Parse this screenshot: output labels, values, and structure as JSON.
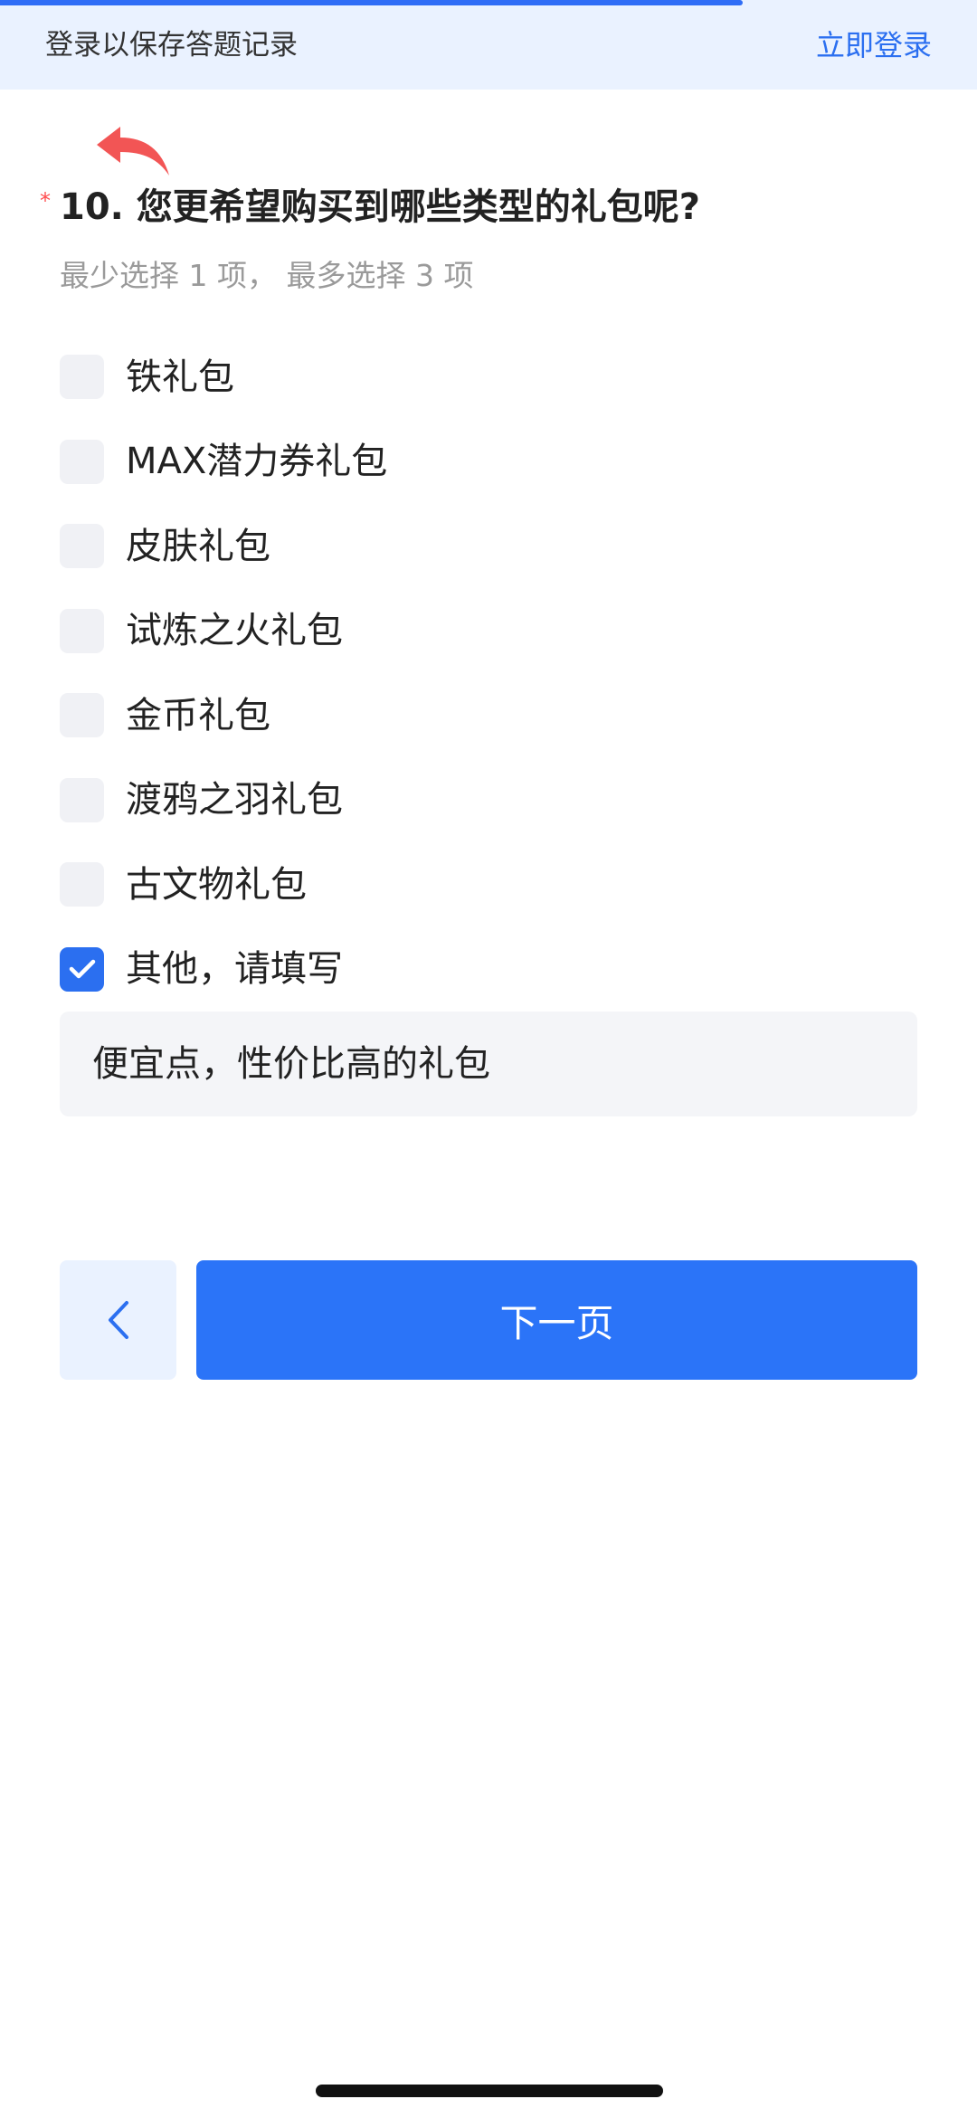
{
  "login_bar": {
    "message": "登录以保存答题记录",
    "login_link": "立即登录",
    "progress_fraction": 0.76
  },
  "question": {
    "required_mark": "*",
    "title": "10. 您更希望购买到哪些类型的礼包呢?",
    "hint": "最少选择 1 项， 最多选择 3 项"
  },
  "options": [
    {
      "label": "铁礼包",
      "checked": false
    },
    {
      "label": "MAX潜力券礼包",
      "checked": false
    },
    {
      "label": "皮肤礼包",
      "checked": false
    },
    {
      "label": "试炼之火礼包",
      "checked": false
    },
    {
      "label": "金币礼包",
      "checked": false
    },
    {
      "label": "渡鸦之羽礼包",
      "checked": false
    },
    {
      "label": "古文物礼包",
      "checked": false
    },
    {
      "label": "其他，请填写",
      "checked": true
    }
  ],
  "other_input": {
    "value": "便宜点，性价比高的礼包"
  },
  "nav": {
    "next_label": "下一页"
  },
  "colors": {
    "accent": "#2b6ff0",
    "bar_bg": "#eaf2ff",
    "checkbox_bg": "#f0f1f5",
    "required": "#ff4d4f",
    "back_arrow": "#f25555"
  },
  "icons": {
    "back": "red-back-arrow-icon",
    "prev": "chevron-left-icon",
    "check": "checkmark-icon"
  }
}
